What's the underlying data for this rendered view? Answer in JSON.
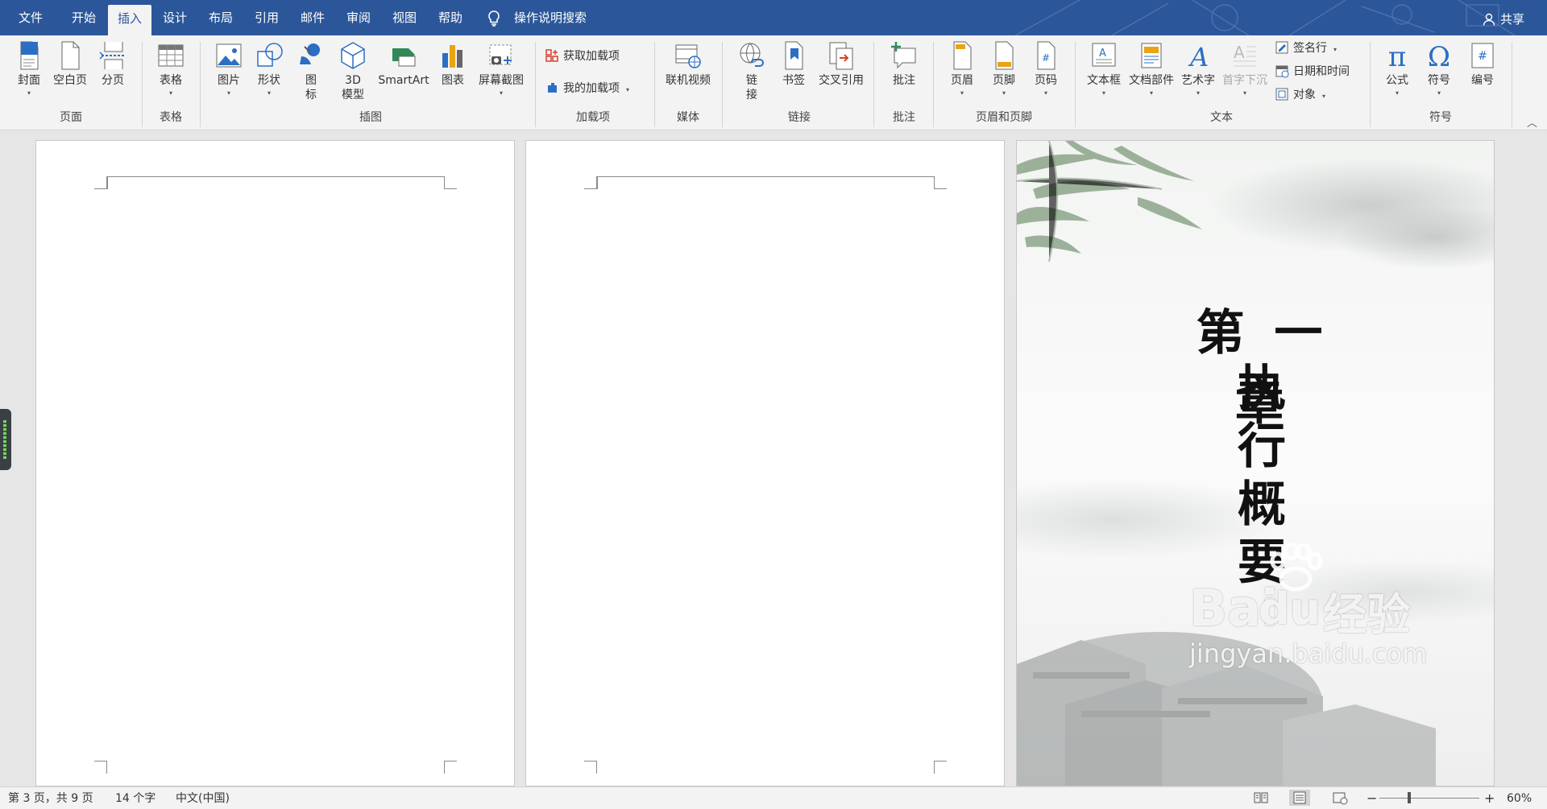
{
  "tabs": {
    "file": "文件",
    "home": "开始",
    "insert": "插入",
    "design": "设计",
    "layout": "布局",
    "references": "引用",
    "mailings": "邮件",
    "review": "审阅",
    "view": "视图",
    "help": "帮助"
  },
  "tell_me": "操作说明搜索",
  "share": "共享",
  "ribbon": {
    "pages": {
      "cover": "封面",
      "blank": "空白页",
      "break": "分页",
      "group": "页面"
    },
    "tables": {
      "table": "表格",
      "group": "表格"
    },
    "illustrations": {
      "picture": "图片",
      "shapes": "形状",
      "icons_1": "图",
      "icons_2": "标",
      "model_1": "3D",
      "model_2": "模型",
      "smartart": "SmartArt",
      "chart": "图表",
      "screenshot": "屏幕截图",
      "group": "插图"
    },
    "addins": {
      "get": "获取加载项",
      "mine": "我的加载项",
      "group": "加载项"
    },
    "media": {
      "video": "联机视频",
      "group": "媒体"
    },
    "links": {
      "link_1": "链",
      "link_2": "接",
      "bookmark": "书签",
      "crossref": "交叉引用",
      "group": "链接"
    },
    "comments": {
      "comment": "批注",
      "group": "批注"
    },
    "header_footer": {
      "header": "页眉",
      "footer": "页脚",
      "page_number": "页码",
      "group": "页眉和页脚"
    },
    "text": {
      "textbox": "文本框",
      "quickparts": "文档部件",
      "wordart": "艺术字",
      "dropcap": "首字下沉",
      "signature": "签名行",
      "datetime": "日期和时间",
      "object": "对象",
      "group": "文本"
    },
    "symbols": {
      "equation": "公式",
      "symbol": "符号",
      "number": "编号",
      "group": "符号"
    }
  },
  "document": {
    "chapter_title": "第 一 章",
    "chapter_subtitle": [
      "执",
      "行",
      "概",
      "要"
    ],
    "watermark_brand": "Bai",
    "watermark_du": "du",
    "watermark_cn": "经验",
    "watermark_url": "jingyan.baidu.com"
  },
  "status": {
    "page": "第 3 页，共 9 页",
    "words": "14 个字",
    "language": "中文(中国)",
    "zoom": "60%",
    "zoom_minus": "−",
    "zoom_plus": "+"
  },
  "colors": {
    "brand": "#2b579a",
    "ribbon_bg": "#f3f3f3",
    "canvas_bg": "#e6e6e6"
  }
}
